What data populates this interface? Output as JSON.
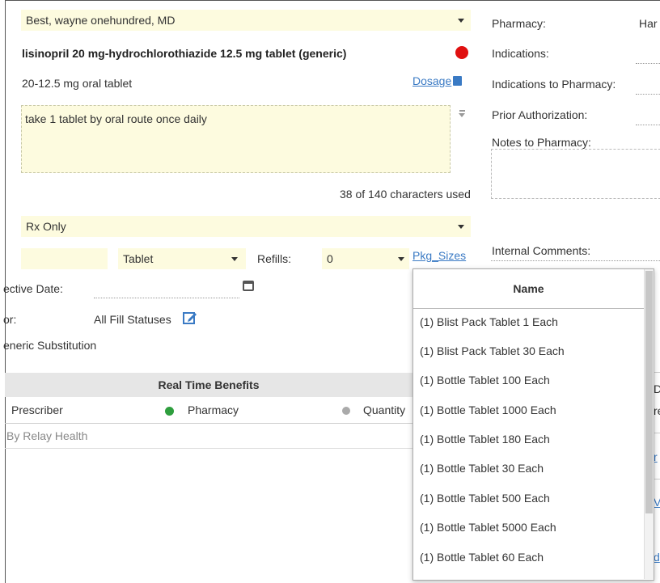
{
  "prescriber_select": {
    "value": "Best, wayne onehundred, MD"
  },
  "drug": {
    "name": "lisinopril 20 mg-hydrochlorothiazide 12.5 mg tablet (generic)",
    "form": "20-12.5 mg oral tablet",
    "dosage_link": "Dosage"
  },
  "sig": {
    "text": "take 1 tablet by oral route once daily",
    "char_count": "38 of 140 characters used"
  },
  "schedule_select": {
    "value": "Rx Only"
  },
  "quantity": {
    "value": "",
    "unit": "Tablet",
    "refills_label": "Refills:",
    "refills_value": "0",
    "pkg_sizes_link": "Pkg_Sizes"
  },
  "effective_date": {
    "label": "ective Date:",
    "value": ""
  },
  "fill_status": {
    "label": "or:",
    "value": "All Fill Statuses"
  },
  "generic_substitution": {
    "label": "eneric Substitution"
  },
  "rtb": {
    "header": "Real Time Benefits",
    "col_prescriber": "Prescriber",
    "col_pharmacy": "Pharmacy",
    "col_quantity": "Quantity",
    "footer": "By Relay Health",
    "pharmacy_status_color": "#2e9e3e"
  },
  "right_panel": {
    "pharmacy_label": "Pharmacy:",
    "pharmacy_value": "Har",
    "indications_label": "Indications:",
    "indications_to_pharmacy_label": "Indications to Pharmacy:",
    "prior_auth_label": "Prior Authorization:",
    "notes_label": "Notes to Pharmacy:",
    "internal_comments_label": "Internal Comments:",
    "cut_1": "De",
    "cut_2": "re",
    "cut_3": "r",
    "cut_4": "V",
    "cut_5": "d"
  },
  "pkg_popup": {
    "header": "Name",
    "items": [
      "(1) Blist Pack Tablet 1 Each",
      "(1) Blist Pack Tablet 30 Each",
      "(1) Bottle Tablet 100 Each",
      "(1) Bottle Tablet 1000 Each",
      "(1) Bottle Tablet 180 Each",
      "(1) Bottle Tablet 30 Each",
      "(1) Bottle Tablet 500 Each",
      "(1) Bottle Tablet 5000 Each",
      "(1) Bottle Tablet 60 Each"
    ]
  },
  "colors": {
    "field_bg": "#fdfbdf",
    "link": "#3a7ac4",
    "alert_red": "#e01010"
  }
}
